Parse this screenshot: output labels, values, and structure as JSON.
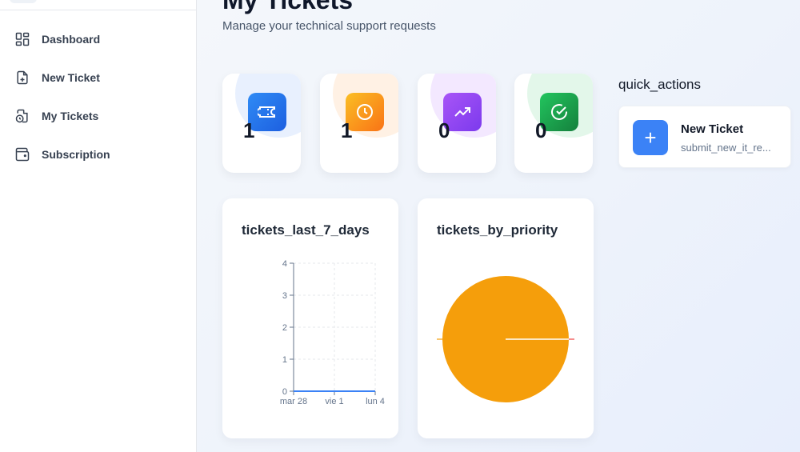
{
  "sidebar": {
    "items": [
      {
        "label": "Dashboard",
        "icon": "dashboard-icon"
      },
      {
        "label": "New Ticket",
        "icon": "file-plus-icon"
      },
      {
        "label": "My Tickets",
        "icon": "file-clock-icon"
      },
      {
        "label": "Subscription",
        "icon": "wallet-icon"
      }
    ]
  },
  "header": {
    "title": "My Tickets",
    "subtitle": "Manage your technical support requests"
  },
  "stats": [
    {
      "value": "1",
      "icon": "ticket-icon",
      "color": "#2563eb"
    },
    {
      "value": "1",
      "icon": "clock-icon",
      "color": "#f97316"
    },
    {
      "value": "0",
      "icon": "trending-up-icon",
      "color": "#9333ea"
    },
    {
      "value": "0",
      "icon": "check-circle-icon",
      "color": "#16a34a"
    }
  ],
  "quick_actions": {
    "title": "quick_actions",
    "items": [
      {
        "name": "New Ticket",
        "description": "submit_new_it_re...",
        "icon": "plus-icon",
        "color": "#3b82f6"
      }
    ]
  },
  "charts": {
    "line_title": "tickets_last_7_days",
    "pie_title": "tickets_by_priority"
  },
  "chart_data": [
    {
      "type": "line",
      "title": "tickets_last_7_days",
      "x": [
        "mar 28",
        "vie 1",
        "lun 4"
      ],
      "series": [
        {
          "values": [
            0,
            0,
            0
          ]
        }
      ],
      "ylim": [
        0,
        4
      ],
      "yticks": [
        "0",
        "1",
        "2",
        "3",
        "4"
      ],
      "grid": true,
      "color": "#3b82f6"
    },
    {
      "type": "pie",
      "title": "tickets_by_priority",
      "values": [
        1
      ],
      "colors": [
        "#f59e0b"
      ]
    }
  ]
}
